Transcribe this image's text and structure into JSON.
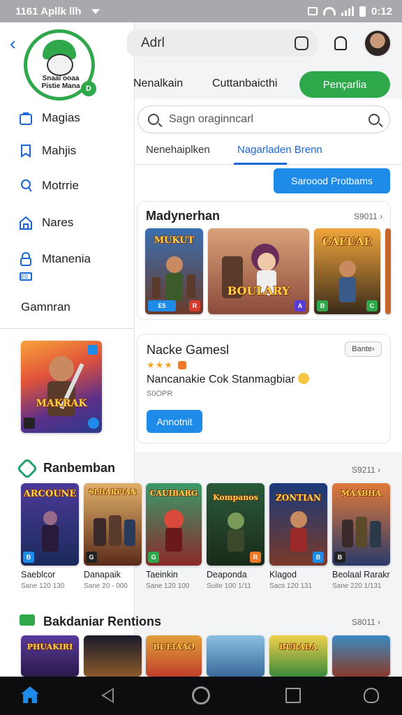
{
  "status_bar": {
    "time": "1161 Apllk llh",
    "right_time": "0:12"
  },
  "drawer": {
    "back_label": "‹",
    "logo_text": "Snaai ooaa Pistie Mana",
    "logo_badge": "D",
    "items": [
      {
        "label": "Magias",
        "icon": "bag-icon"
      },
      {
        "label": "Mahjis",
        "icon": "bookmark-icon"
      },
      {
        "label": "Motrrie",
        "icon": "person-icon"
      },
      {
        "label": "Nares",
        "icon": "home-icon"
      },
      {
        "label": "Mtanenia",
        "icon": "lock-icon"
      }
    ],
    "sub_badge": "E0",
    "games_label": "Gamnran",
    "card_title": "MAKRAK"
  },
  "top_bar": {
    "search_text": "Adrl",
    "icons": [
      "bell-icon",
      "avatar"
    ]
  },
  "tabs": [
    "Nenalkain",
    "Cuttanbaicthi",
    "Pençarlia"
  ],
  "search": {
    "placeholder": "Sagn oraginncarl"
  },
  "subtabs": [
    "Nenehaiplken",
    "Nagarladen Brenn"
  ],
  "blue_button": "Saroood Protbams",
  "featured": {
    "title": "Madynerhan",
    "see_all": "S9011 ›",
    "tiles": [
      {
        "title": "MUKUT",
        "chip1": "E5",
        "chip2": "R"
      },
      {
        "title": "BOULARY",
        "chip1": "",
        "chip2": "A"
      },
      {
        "title": "CAEUAE",
        "chip1": "B",
        "chip2": "C"
      }
    ]
  },
  "game_card": {
    "title": "Nacke Gamesl",
    "stars": "★★★",
    "description": "Nancanakie Cok Stanmagbiar",
    "price": "S0OPR",
    "button": "Annotnit",
    "tag": "Bante›"
  },
  "recommended": {
    "title": "Ranbemban",
    "see_all": "S9211 ›",
    "items": [
      {
        "name": "Saeblcor",
        "sub": "Sane 120 130",
        "art": "ARCOUNE",
        "chip": "B"
      },
      {
        "name": "Danapaik",
        "sub": "Sane 20 - 000",
        "art": "SLHARFIAN",
        "chip": "G"
      },
      {
        "name": "Taeinkin",
        "sub": "Sane 120 100",
        "art": "CAUIBARG",
        "chip": "G"
      },
      {
        "name": "Deaponda",
        "sub": "Suite 100 1/11",
        "art": "Kompanos",
        "chip": "R"
      },
      {
        "name": "Klagod",
        "sub": "Sacs 120 131",
        "art": "ZONTIAN",
        "chip": "B"
      },
      {
        "name": "Beolaal Rarakr",
        "sub": "Sane 220 1/131",
        "art": "MAABHA",
        "chip": "B"
      }
    ]
  },
  "related": {
    "title": "Bakdaniar Rentions",
    "see_all": "S8011 ›",
    "arts": [
      "PHUAKIRI",
      "",
      "BUEIAAO",
      "",
      "BURADA",
      ""
    ]
  },
  "colors": {
    "accent_green": "#2ea84a",
    "accent_blue": "#1f8be8",
    "link_blue": "#1a66d6"
  }
}
